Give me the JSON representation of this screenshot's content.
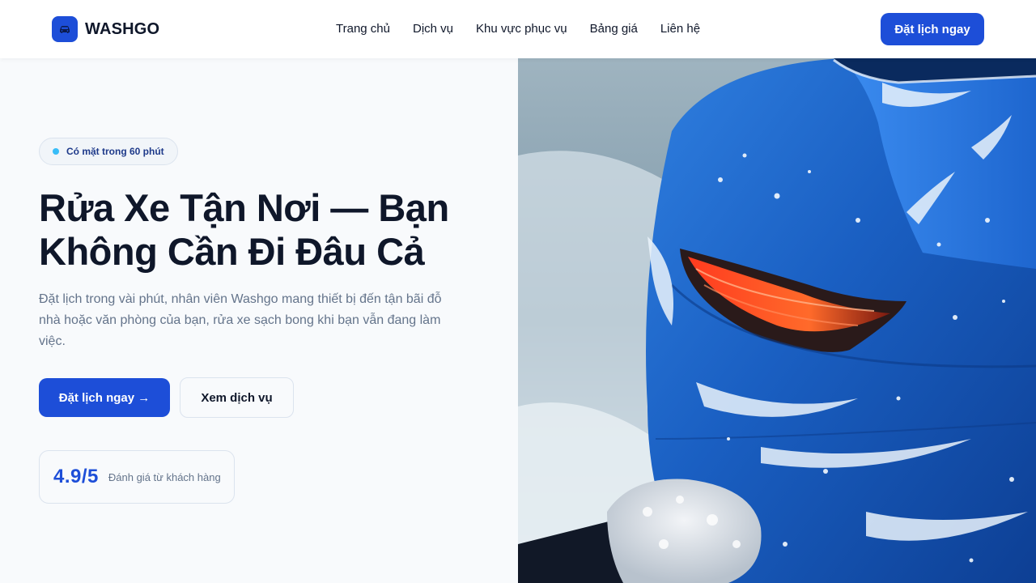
{
  "brand": {
    "name": "WASHGO",
    "logo_icon": "car-icon",
    "color": "#1d4ed8"
  },
  "nav": {
    "items": [
      {
        "label": "Trang chủ"
      },
      {
        "label": "Dịch vụ"
      },
      {
        "label": "Khu vực phục vụ"
      },
      {
        "label": "Bảng giá"
      },
      {
        "label": "Liên hệ"
      }
    ],
    "cta_label": "Đặt lịch ngay"
  },
  "hero": {
    "badge": "Có mặt trong 60 phút",
    "headline_line1": "Rửa Xe Tận Nơi — Bạn",
    "headline_line2": "Không Cần Đi Đâu Cả",
    "lead": "Đặt lịch trong vài phút, nhân viên Washgo mang thiết bị đến tận bãi đỗ nhà hoặc văn phòng của bạn, rửa xe sạch bong khi bạn vẫn đang làm việc.",
    "primary_cta": "Đặt lịch ngay →",
    "secondary_cta": "Xem dịch vụ",
    "rating": {
      "score": "4.9/5",
      "label": "Đánh giá từ khách hàng"
    }
  },
  "image": {
    "subject": "blue car covered in soap foam being washed by a gloved hand"
  },
  "colors": {
    "primary": "#1d4ed8",
    "text": "#0f172a",
    "muted": "#64748b",
    "badge_dot": "#38bdf8"
  }
}
